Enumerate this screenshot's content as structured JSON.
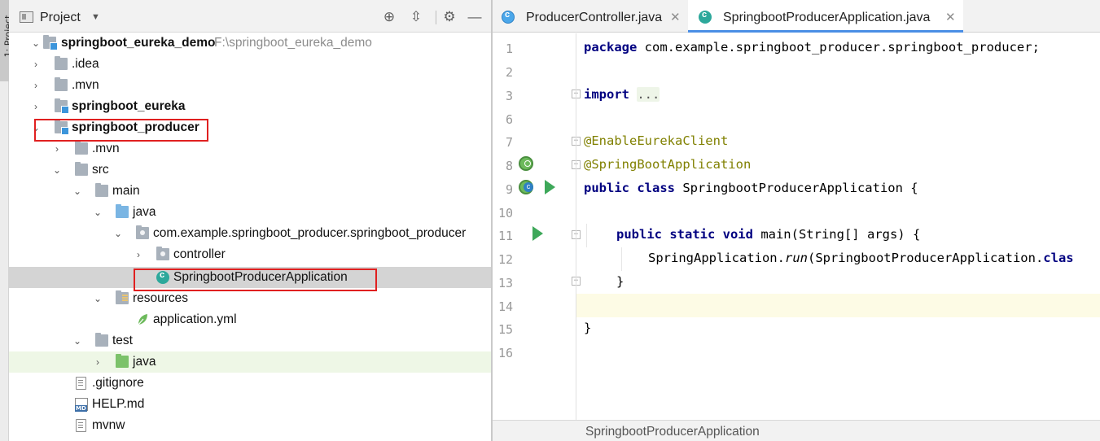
{
  "side_stripe": {
    "label": "1: Project"
  },
  "project_panel": {
    "title": "Project",
    "tree": [
      {
        "label": "springboot_eureka_demo",
        "path": "F:\\springboot_eureka_demo",
        "bold": true,
        "expanded": true,
        "icon": "module-folder-icon"
      },
      {
        "label": ".idea",
        "icon": "folder-icon"
      },
      {
        "label": ".mvn",
        "icon": "folder-icon"
      },
      {
        "label": "springboot_eureka",
        "bold": true,
        "icon": "module-folder-icon"
      },
      {
        "label": "springboot_producer",
        "bold": true,
        "expanded": true,
        "icon": "module-folder-icon"
      },
      {
        "label": ".mvn",
        "icon": "folder-icon"
      },
      {
        "label": "src",
        "icon": "folder-icon"
      },
      {
        "label": "main",
        "icon": "folder-icon"
      },
      {
        "label": "java",
        "icon": "source-folder-icon"
      },
      {
        "label": "com.example.springboot_producer.springboot_producer",
        "icon": "package-icon"
      },
      {
        "label": "controller",
        "icon": "package-icon"
      },
      {
        "label": "SpringbootProducerApplication",
        "icon": "spring-class-icon",
        "selected": true
      },
      {
        "label": "resources",
        "icon": "resources-folder-icon"
      },
      {
        "label": "application.yml",
        "icon": "spring-leaf-icon"
      },
      {
        "label": "test",
        "icon": "folder-icon"
      },
      {
        "label": "java",
        "icon": "test-source-folder-icon"
      },
      {
        "label": ".gitignore",
        "icon": "file-icon"
      },
      {
        "label": "HELP.md",
        "icon": "markdown-file-icon"
      },
      {
        "label": "mvnw",
        "icon": "file-icon"
      }
    ]
  },
  "editor": {
    "tabs": [
      {
        "label": "ProducerController.java",
        "active": false
      },
      {
        "label": "SpringbootProducerApplication.java",
        "active": true
      }
    ],
    "line_numbers": [
      "1",
      "2",
      "3",
      "6",
      "7",
      "8",
      "9",
      "10",
      "11",
      "12",
      "13",
      "14",
      "15",
      "16"
    ],
    "code": {
      "line1_kw": "package",
      "line1_rest": " com.example.springboot_producer.springboot_producer;",
      "line3_kw": "import",
      "line3_folded": "...",
      "line7_ann": "@EnableEurekaClient",
      "line8_ann": "@SpringBootApplication",
      "line9_kw": "public class",
      "line9_rest": " SpringbootProducerApplication {",
      "line11_kw": "public static void",
      "line11_rest": " main(String[] args) {",
      "line12_pre": "SpringApplication.",
      "line12_method": "run",
      "line12_post": "(SpringbootProducerApplication.",
      "line12_kw": "clas",
      "line13": "}",
      "line15": "}"
    },
    "breadcrumb": "SpringbootProducerApplication"
  },
  "colors": {
    "keyword": "#000080",
    "annotation": "#808000",
    "highlight_box": "#e02020",
    "tab_active_underline": "#4a8ee5",
    "selection_row": "#d4d4d4"
  }
}
